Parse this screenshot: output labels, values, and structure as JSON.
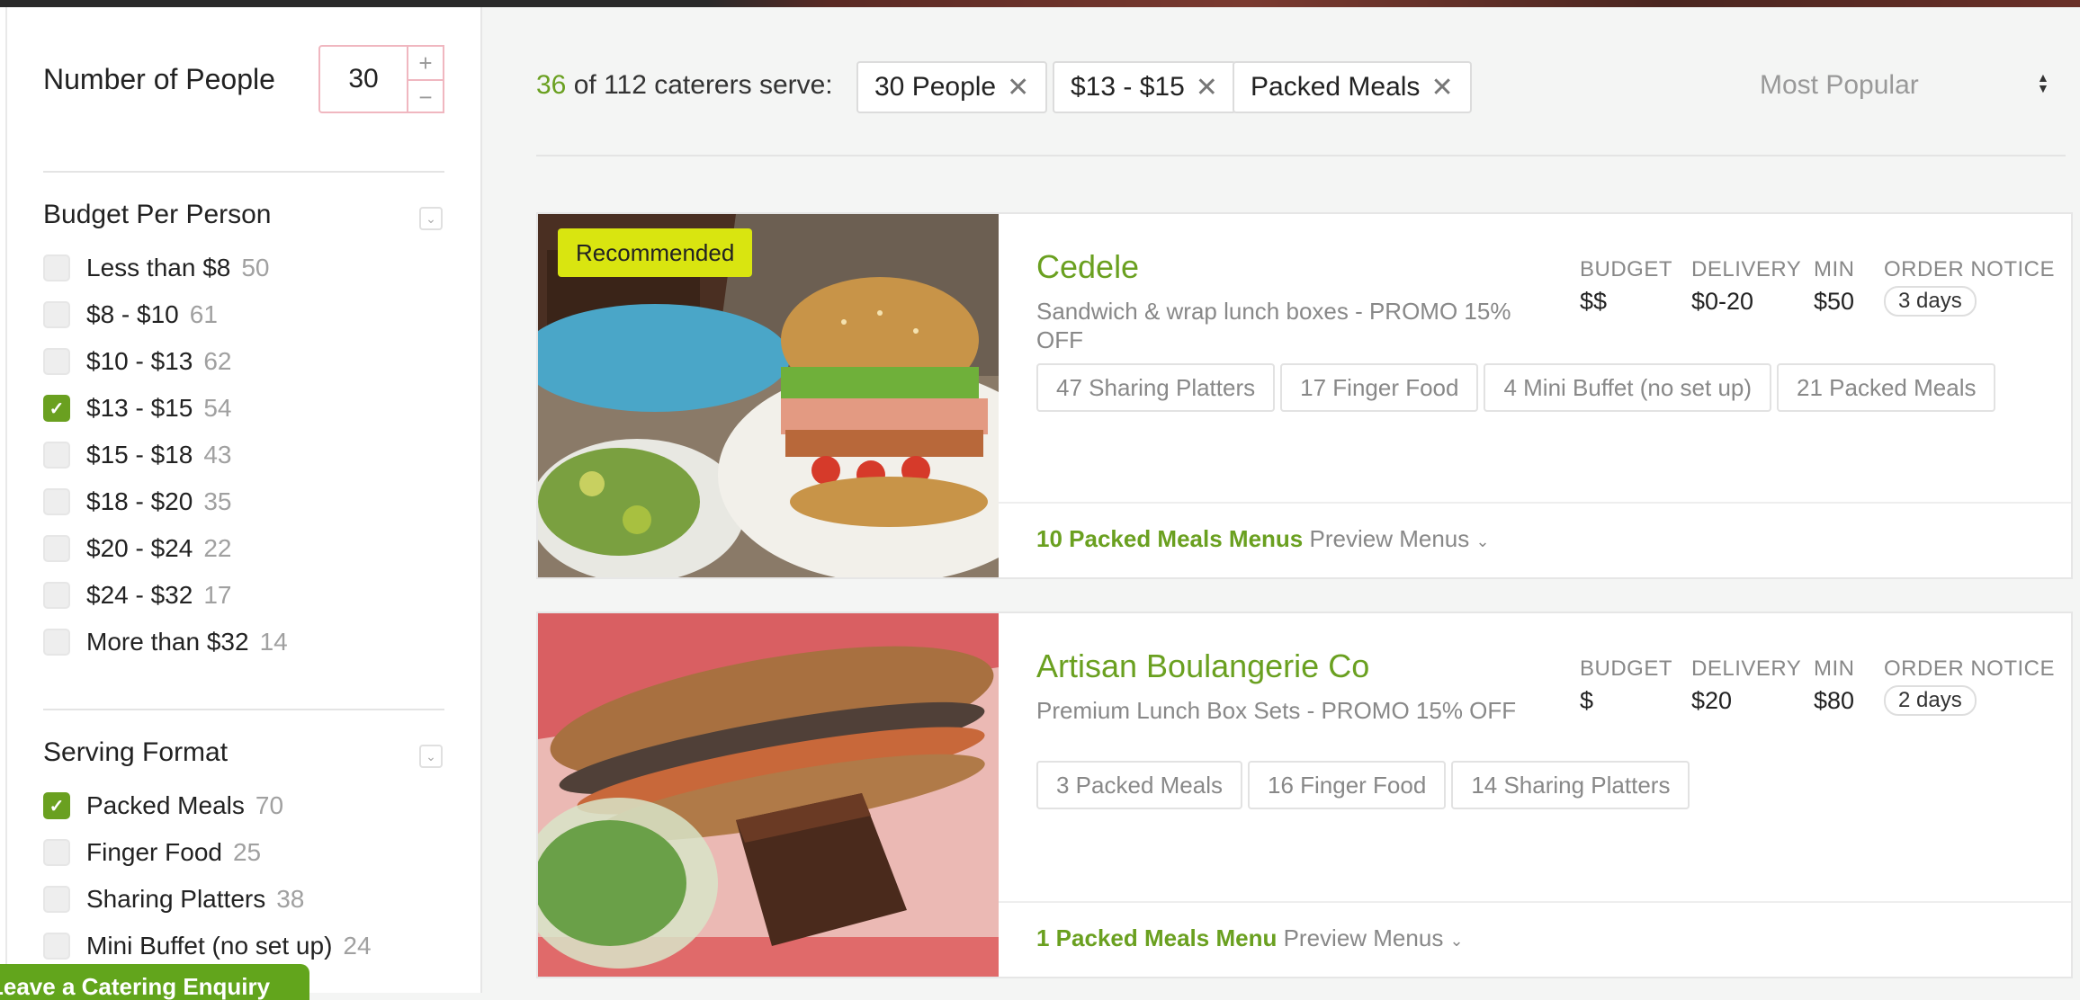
{
  "filters": {
    "people": {
      "label": "Number of People",
      "value": "30",
      "plus": "+",
      "minus": "−"
    },
    "budget": {
      "title": "Budget Per Person",
      "options": [
        {
          "label": "Less than $8",
          "count": "50",
          "checked": false
        },
        {
          "label": "$8 - $10",
          "count": "61",
          "checked": false
        },
        {
          "label": "$10 - $13",
          "count": "62",
          "checked": false
        },
        {
          "label": "$13 - $15",
          "count": "54",
          "checked": true
        },
        {
          "label": "$15 - $18",
          "count": "43",
          "checked": false
        },
        {
          "label": "$18 - $20",
          "count": "35",
          "checked": false
        },
        {
          "label": "$20 - $24",
          "count": "22",
          "checked": false
        },
        {
          "label": "$24 - $32",
          "count": "17",
          "checked": false
        },
        {
          "label": "More than $32",
          "count": "14",
          "checked": false
        }
      ]
    },
    "format": {
      "title": "Serving Format",
      "options": [
        {
          "label": "Packed Meals",
          "count": "70",
          "checked": true
        },
        {
          "label": "Finger Food",
          "count": "25",
          "checked": false
        },
        {
          "label": "Sharing Platters",
          "count": "38",
          "checked": false
        },
        {
          "label": "Mini Buffet (no set up)",
          "count": "24",
          "checked": false
        }
      ]
    },
    "enquiry_label": "Leave a Catering Enquiry"
  },
  "results": {
    "count": "36",
    "summary_rest": "of 112 caterers serve:",
    "chips": [
      "30 People",
      "$13 - $15",
      "Packed Meals"
    ],
    "sort_label": "Most Popular"
  },
  "meta_labels": {
    "budget": "BUDGET",
    "delivery": "DELIVERY",
    "min": "MIN",
    "notice": "ORDER NOTICE"
  },
  "caterers": [
    {
      "badge": "Recommended",
      "name": "Cedele",
      "description": "Sandwich & wrap lunch boxes - PROMO 15% OFF",
      "budget": "$$",
      "delivery": "$0-20",
      "min": "$50",
      "notice": "3 days",
      "tags": [
        "47 Sharing Platters",
        "17 Finger Food",
        "4 Mini Buffet (no set up)",
        "21 Packed Meals"
      ],
      "menus": "10 Packed Meals Menus",
      "preview": "Preview Menus"
    },
    {
      "name": "Artisan Boulangerie Co",
      "description": "Premium Lunch Box Sets - PROMO 15% OFF",
      "budget": "$",
      "delivery": "$20",
      "min": "$80",
      "notice": "2 days",
      "tags": [
        "3 Packed Meals",
        "16 Finger Food",
        "14 Sharing Platters"
      ],
      "menus": "1 Packed Meals Menu",
      "preview": "Preview Menus"
    }
  ],
  "colors": {
    "accent": "#6aa020",
    "badge": "#d9e510",
    "input_border": "#f0b7c0"
  },
  "icons": {
    "chip_remove": "close-icon",
    "sort": "sort-arrows-icon",
    "collapse": "chevron-down-icon",
    "check": "checkmark-icon"
  }
}
